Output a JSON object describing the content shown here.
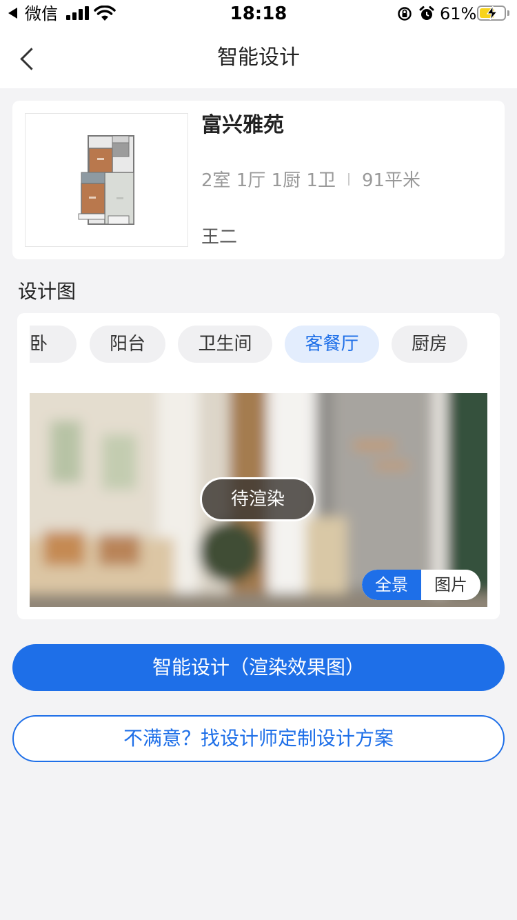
{
  "status_bar": {
    "carrier": "微信",
    "time": "18:18",
    "battery": "61%",
    "battery_level": 0.61
  },
  "nav": {
    "title": "智能设计",
    "back_icon": "chevron-left-icon"
  },
  "house": {
    "name": "富兴雅苑",
    "layout": "2室 1厅 1厨 1卫",
    "area": "91平米",
    "owner": "王二"
  },
  "design": {
    "section_title": "设计图",
    "tabs": [
      {
        "label": "主卧",
        "active": false
      },
      {
        "label": "阳台",
        "active": false
      },
      {
        "label": "卫生间",
        "active": false
      },
      {
        "label": "客餐厅",
        "active": true
      },
      {
        "label": "厨房",
        "active": false
      }
    ],
    "render_status": "待渲染",
    "view_toggle": {
      "panorama": "全景",
      "image": "图片",
      "selected": "全景"
    }
  },
  "actions": {
    "primary": "智能设计（渲染效果图）",
    "secondary": "不满意？找设计师定制设计方案"
  },
  "colors": {
    "accent": "#1e6fe8",
    "tab_active_bg": "#e3edfd",
    "page_bg": "#f3f3f5",
    "battery_fill": "#f7d31c"
  }
}
